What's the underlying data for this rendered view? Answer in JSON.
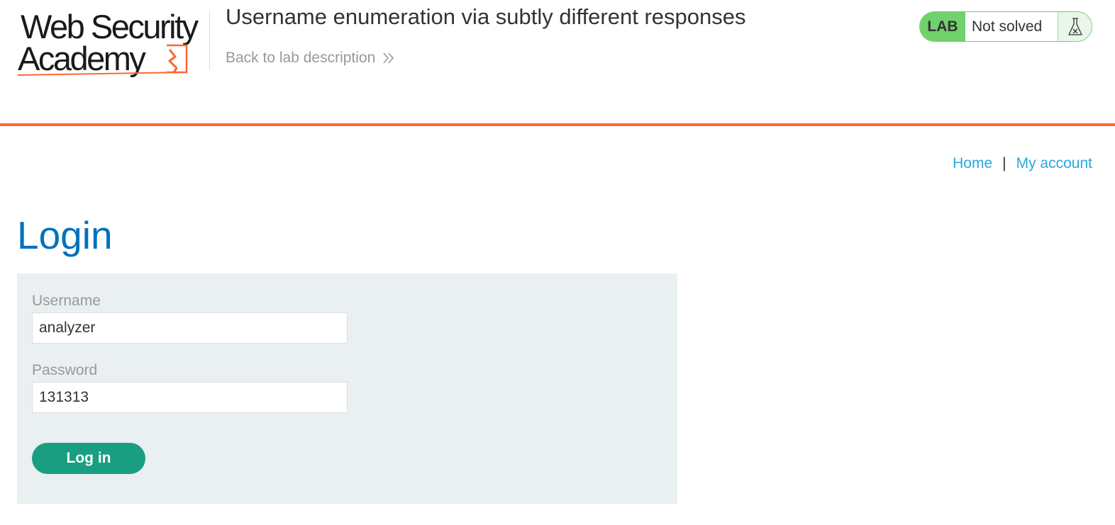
{
  "logo": {
    "line1": "Web Security",
    "line2": "Academy"
  },
  "lab": {
    "title": "Username enumeration via subtly different responses",
    "back_link": "Back to lab description",
    "status_badge": "LAB",
    "status_text": "Not solved",
    "status_icon": "flask-icon"
  },
  "nav": {
    "home": "Home",
    "separator": "|",
    "my_account": "My account"
  },
  "page": {
    "title": "Login"
  },
  "form": {
    "username_label": "Username",
    "username_value": "analyzer",
    "password_label": "Password",
    "password_value": "131313",
    "submit_label": "Log in"
  },
  "colors": {
    "accent_orange": "#ff6633",
    "title_blue": "#0071bc",
    "link_blue": "#29a9df",
    "lab_green": "#70d16d",
    "button_green": "#1a9e81",
    "panel_gray": "#eaeff1"
  }
}
